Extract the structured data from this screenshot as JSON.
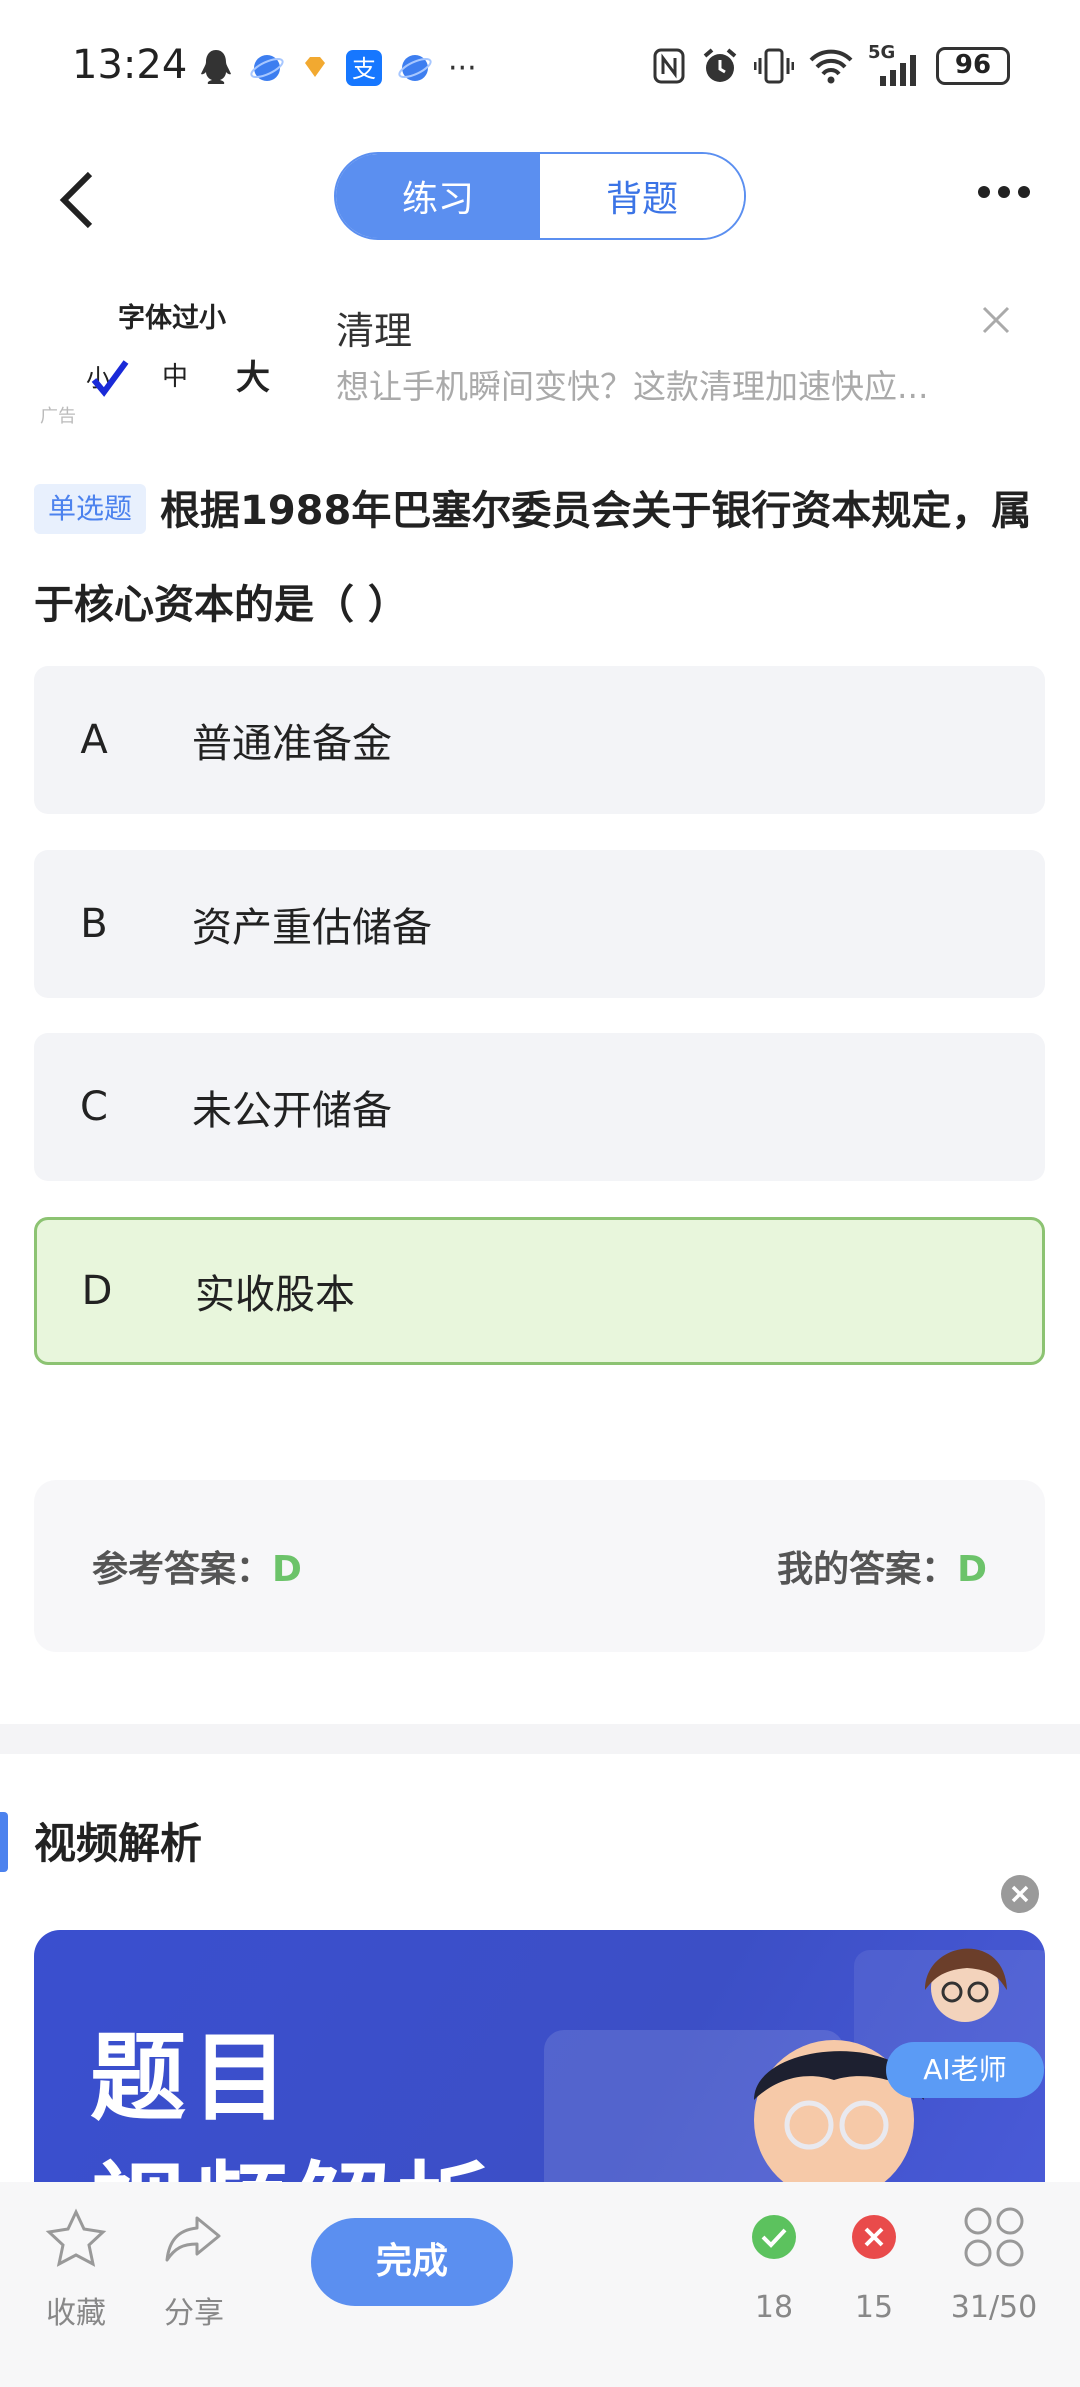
{
  "status_bar": {
    "time": "13:24",
    "battery": "96",
    "network": "5G"
  },
  "header": {
    "tabs": [
      {
        "label": "练习",
        "active": true
      },
      {
        "label": "背题",
        "active": false
      }
    ]
  },
  "ad": {
    "font_size_title": "字体过小",
    "font_sizes": [
      "小",
      "中",
      "大"
    ],
    "ad_label": "广告",
    "title": "清理",
    "subtitle": "想让手机瞬间变快？这款清理加速快应..."
  },
  "question": {
    "type_tag": "单选题",
    "stem": "根据1988年巴塞尔委员会关于银行资本规定，属于核心资本的是（ ）",
    "options": [
      {
        "letter": "A",
        "text": "普通准备金"
      },
      {
        "letter": "B",
        "text": "资产重估储备"
      },
      {
        "letter": "C",
        "text": "未公开储备"
      },
      {
        "letter": "D",
        "text": "实收股本"
      }
    ]
  },
  "answer": {
    "reference_label": "参考答案：",
    "reference_value": "D",
    "mine_label": "我的答案：",
    "mine_value": "D"
  },
  "video_section": {
    "title": "视频解析",
    "banner_line1": "题目",
    "banner_line2": "视频解析",
    "ai_badge": "AI老师"
  },
  "bottom_bar": {
    "favorite": "收藏",
    "share": "分享",
    "finish": "完成",
    "correct_count": "18",
    "wrong_count": "15",
    "progress": "31/50"
  },
  "colors": {
    "accent": "#5b8ff0",
    "correct": "#6cc36a",
    "wrong": "#e94b4b"
  }
}
